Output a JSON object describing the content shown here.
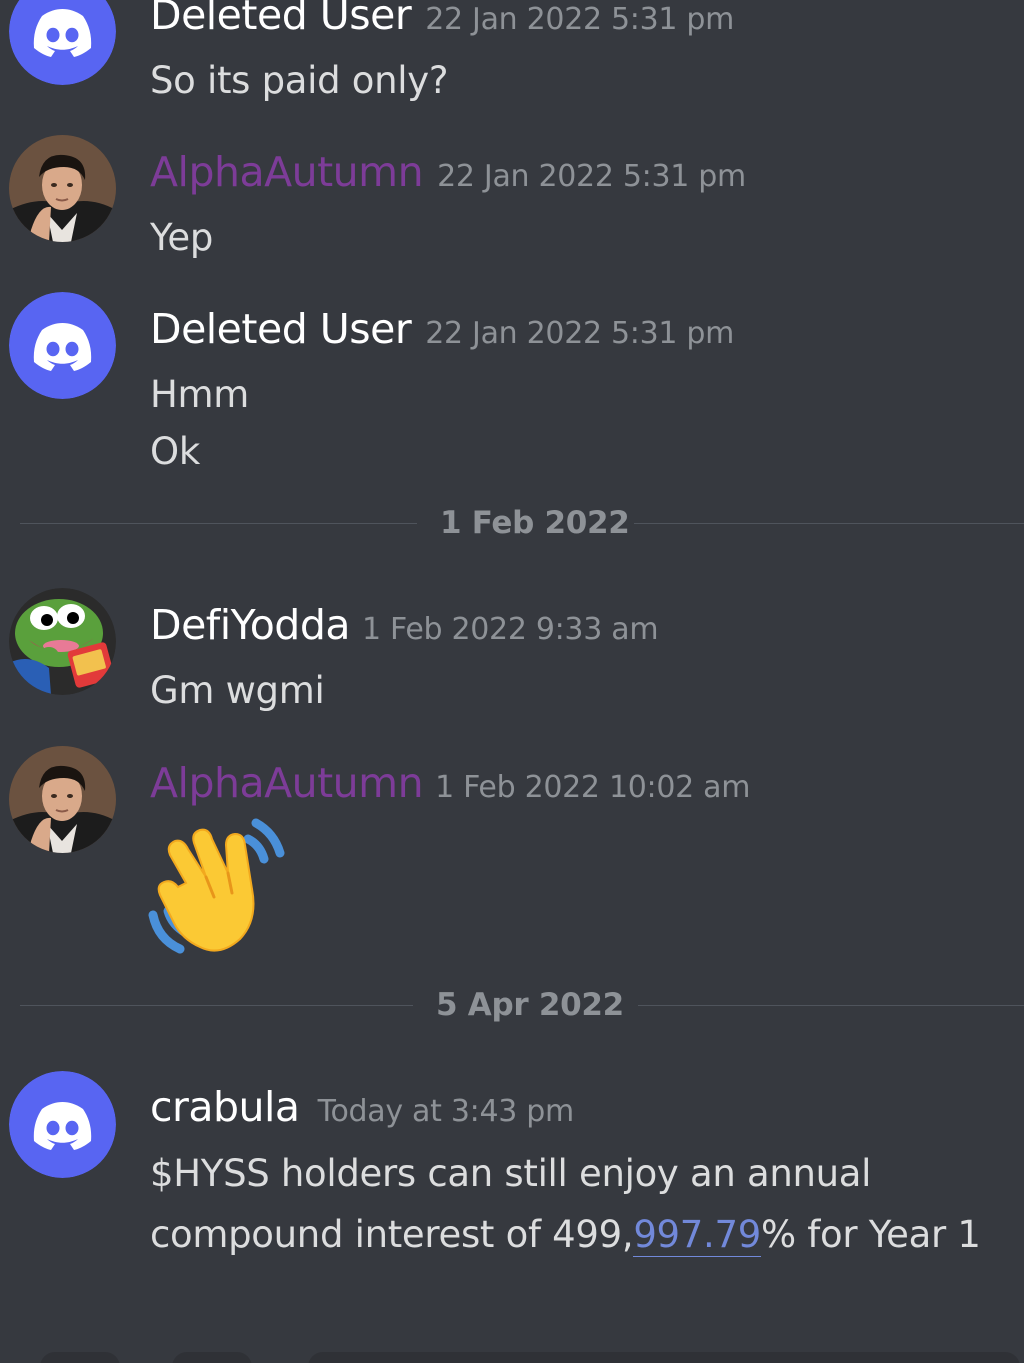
{
  "messages": [
    {
      "author": "Deleted User",
      "timestamp": "22 Jan 2022 5:31 pm",
      "lines": [
        "So its paid only?"
      ]
    },
    {
      "author": "AlphaAutumn",
      "timestamp": "22 Jan 2022 5:31 pm",
      "lines": [
        "Yep"
      ]
    },
    {
      "author": "Deleted User",
      "timestamp": "22 Jan 2022 5:31 pm",
      "lines": [
        "Hmm",
        "Ok"
      ]
    },
    {
      "author": "DefiYodda",
      "timestamp": "1 Feb 2022 9:33 am",
      "lines": [
        "Gm wgmi"
      ]
    },
    {
      "author": "AlphaAutumn",
      "timestamp": "1 Feb 2022 10:02 am",
      "emoji": "waving-hand"
    },
    {
      "author": "crabula",
      "timestamp": "Today at 3:43 pm",
      "lines": [
        "$HYSS holders can still enjoy an annual"
      ],
      "line2_before": "compound interest of 499,",
      "line2_link": "997.79",
      "line2_after": "% for Year 1"
    }
  ],
  "dividers": [
    "1 Feb 2022",
    "5 Apr 2022"
  ],
  "colors": {
    "background": "#36393f",
    "author_default": "#ffffff",
    "author_alpha": "#7d3c98",
    "timestamp": "#8e9297",
    "message_text": "#dcddde",
    "blurple": "#5865f2",
    "link": "#7289da"
  },
  "icons": {
    "default_avatar": "discord-logo-icon",
    "alpha_avatar": "profile-photo",
    "defi_avatar": "pepe-frog",
    "emoji": "waving-hand-icon"
  }
}
